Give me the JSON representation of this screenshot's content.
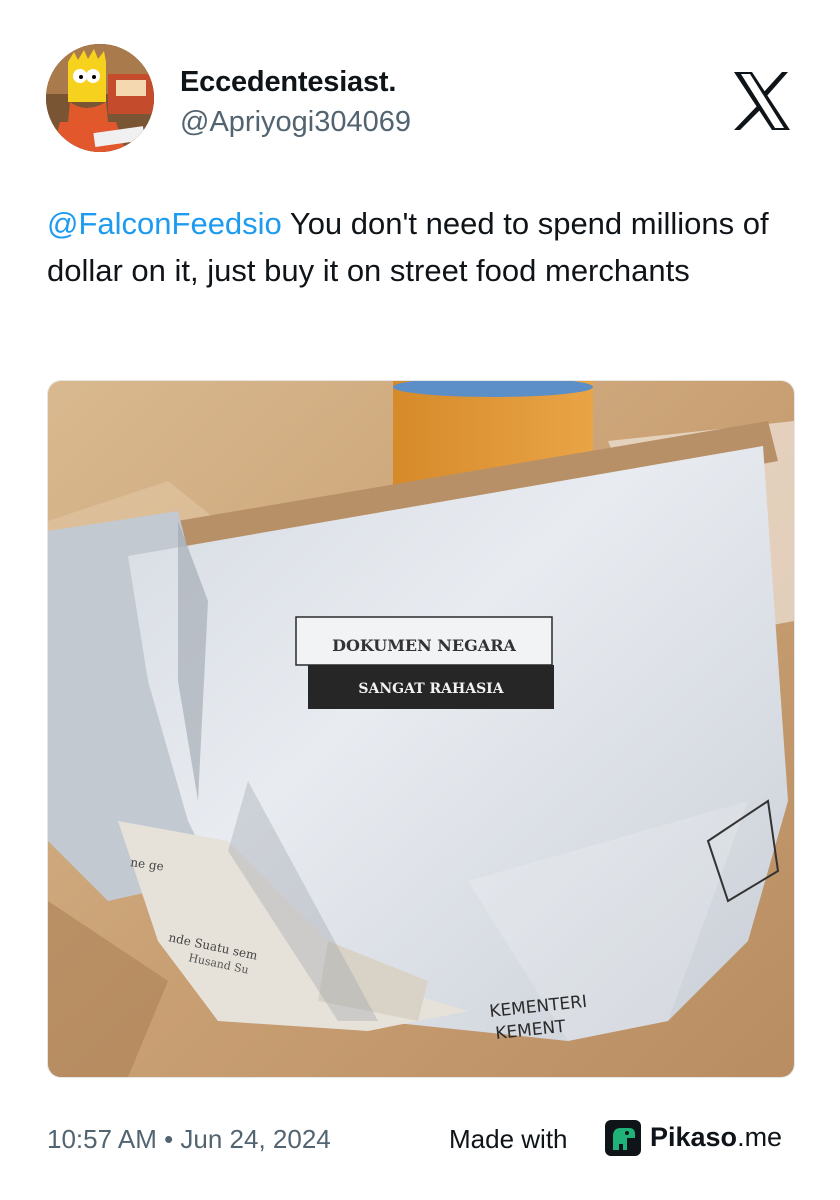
{
  "user": {
    "display_name": "Eccedentesiast.",
    "handle": "@Apriyogi304069",
    "avatar_icon": "bart-simpson-avatar"
  },
  "platform": {
    "logo_icon": "x-logo-icon"
  },
  "tweet": {
    "mention": "@FalconFeedsio",
    "text": " You don't need to spend millions of dollar on it, just buy it on street food merchants"
  },
  "media": {
    "label_line1": "DOKUMEN NEGARA",
    "label_line2": "SANGAT RAHASIA",
    "bottom_text1": "KEMENTERI",
    "bottom_text2": "KEMENT"
  },
  "footer": {
    "timestamp": "10:57 AM • Jun 24, 2024",
    "made_with": "Made with",
    "brand_name": "Pikaso",
    "brand_tld": ".me"
  },
  "colors": {
    "mention": "#1d9bf0",
    "secondary_text": "#536471",
    "brand_green": "#1fb37a"
  }
}
